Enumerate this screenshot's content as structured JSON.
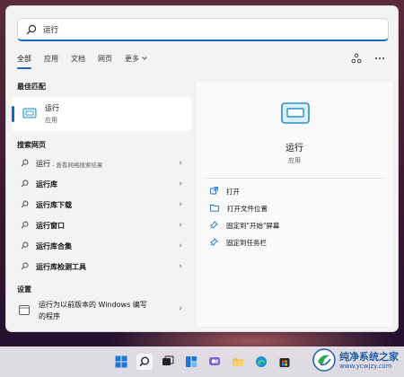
{
  "search": {
    "value": "运行"
  },
  "tabs": [
    {
      "label": "全部",
      "active": true
    },
    {
      "label": "应用"
    },
    {
      "label": "文档"
    },
    {
      "label": "网页"
    },
    {
      "label": "更多"
    }
  ],
  "icons": {
    "share": "share-icon",
    "more": "more-icon"
  },
  "best_match": {
    "heading": "最佳匹配",
    "title": "运行",
    "subtitle": "应用"
  },
  "web": {
    "heading": "搜索网页",
    "items": [
      {
        "label": "运行",
        "sub": " - 查看网络搜索结果"
      },
      {
        "label": "运行库"
      },
      {
        "label": "运行库下载"
      },
      {
        "label": "运行窗口"
      },
      {
        "label": "运行库合集"
      },
      {
        "label": "运行库检测工具"
      }
    ]
  },
  "settings": {
    "heading": "设置",
    "item_line1": "运行为以前版本的 Windows 编写",
    "item_line2": "的程序"
  },
  "detail": {
    "title": "运行",
    "subtitle": "应用",
    "actions": [
      "打开",
      "打开文件位置",
      "固定到\"开始\"屏幕",
      "固定到任务栏"
    ]
  },
  "watermark": {
    "title": "纯净系统之家",
    "url": "www.ycwjzy.com"
  },
  "colors": {
    "accent": "#1a66c4"
  }
}
